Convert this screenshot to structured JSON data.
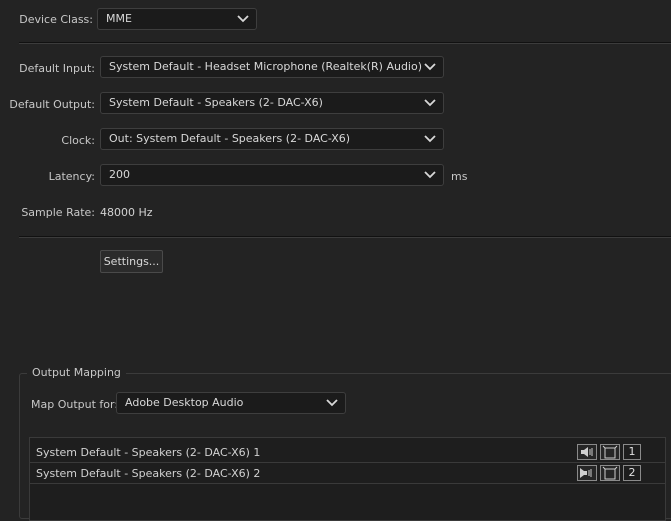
{
  "device_class": {
    "label": "Device Class:",
    "value": "MME"
  },
  "default_input": {
    "label": "Default Input:",
    "value": "System Default - Headset Microphone (Realtek(R) Audio)"
  },
  "default_output": {
    "label": "Default Output:",
    "value": "System Default - Speakers (2- DAC-X6)"
  },
  "clock": {
    "label": "Clock:",
    "value": "Out: System Default - Speakers (2- DAC-X6)"
  },
  "latency": {
    "label": "Latency:",
    "value": "200",
    "unit": "ms"
  },
  "sample_rate": {
    "label": "Sample Rate:",
    "value": "48000 Hz"
  },
  "settings_button": "Settings...",
  "output_mapping": {
    "title": "Output Mapping",
    "map_label": "Map Output for:",
    "map_value": "Adobe Desktop Audio",
    "rows": [
      {
        "label": "System Default - Speakers (2- DAC-X6) 1",
        "channel": "1"
      },
      {
        "label": "System Default - Speakers (2- DAC-X6) 2",
        "channel": "2"
      }
    ]
  }
}
